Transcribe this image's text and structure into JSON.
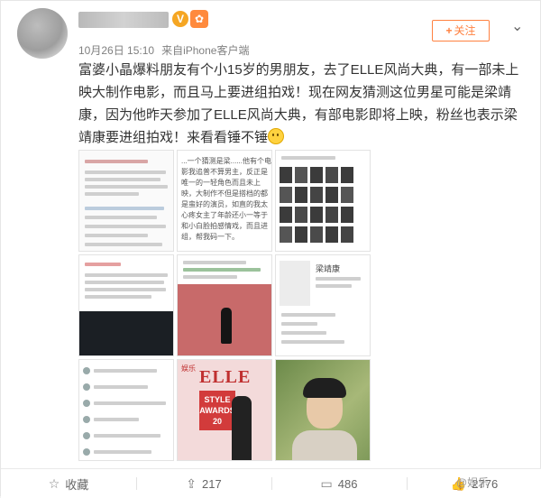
{
  "header": {
    "time": "10月26日 15:10",
    "source_prefix": "来自",
    "source": "iPhone客户端",
    "verified_badge": "V",
    "follow_label": "关注",
    "follow_plus": "+",
    "more_icon": "chevron-down-icon"
  },
  "post": {
    "text": "富婆小晶爆料朋友有个小15岁的男朋友，去了ELLE风尚大典，有一部未上映大制作电影，而且马上要进组拍戏！现在网友猜测这位男星可能是梁靖康，因为他昨天参加了ELLE风尚大典，有部电影即将上映，粉丝也表示梁靖康要进组拍戏！来看看锤不锤"
  },
  "images": {
    "t2_text": "...一个猜测是梁......他有个电影我追普不算男主，反正是唯一的一轻角色而且未上映，大制作不但是搭档的都是蛮好的演员，如直的我太心疼女主了年龄还小一等于和小白脸拍感情戏，而且进组，帮我码一下。",
    "t8_logo": "ELLE",
    "t8_style": "STYLE AWARDS 20",
    "t8_flag": "娱乐",
    "t6_name": "梁靖康"
  },
  "actions": [
    {
      "label": "收藏",
      "icon": "star-icon"
    },
    {
      "label": "217",
      "icon": "share-icon"
    },
    {
      "label": "486",
      "icon": "comment-icon"
    },
    {
      "label": "2776",
      "icon": "like-icon"
    }
  ],
  "watermark": "@娱乐"
}
